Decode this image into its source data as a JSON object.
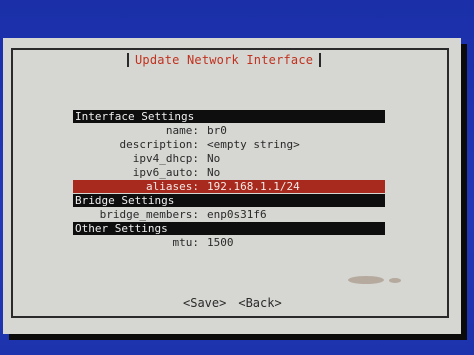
{
  "dialog": {
    "title": "Update Network Interface"
  },
  "sections": [
    {
      "header": "Interface Settings",
      "rows": [
        {
          "label": "name:",
          "value": "br0"
        },
        {
          "label": "description:",
          "value": "<empty string>"
        },
        {
          "label": "ipv4_dhcp:",
          "value": "No"
        },
        {
          "label": "ipv6_auto:",
          "value": "No"
        },
        {
          "label": "aliases:",
          "value": "192.168.1.1/24",
          "selected": true
        }
      ]
    },
    {
      "header": "Bridge Settings",
      "rows": [
        {
          "label": "bridge_members:",
          "value": "enp0s31f6"
        }
      ]
    },
    {
      "header": "Other Settings",
      "rows": [
        {
          "label": "mtu:",
          "value": "1500"
        }
      ]
    }
  ],
  "buttons": {
    "save": "<Save>",
    "back": "<Back>"
  },
  "colors": {
    "background": "#1f35b0",
    "dialog": "#d6d6d2",
    "title_text": "#c0321f",
    "section_header_bg": "#0e0e0e",
    "selected_row_bg": "#a82a1e"
  }
}
